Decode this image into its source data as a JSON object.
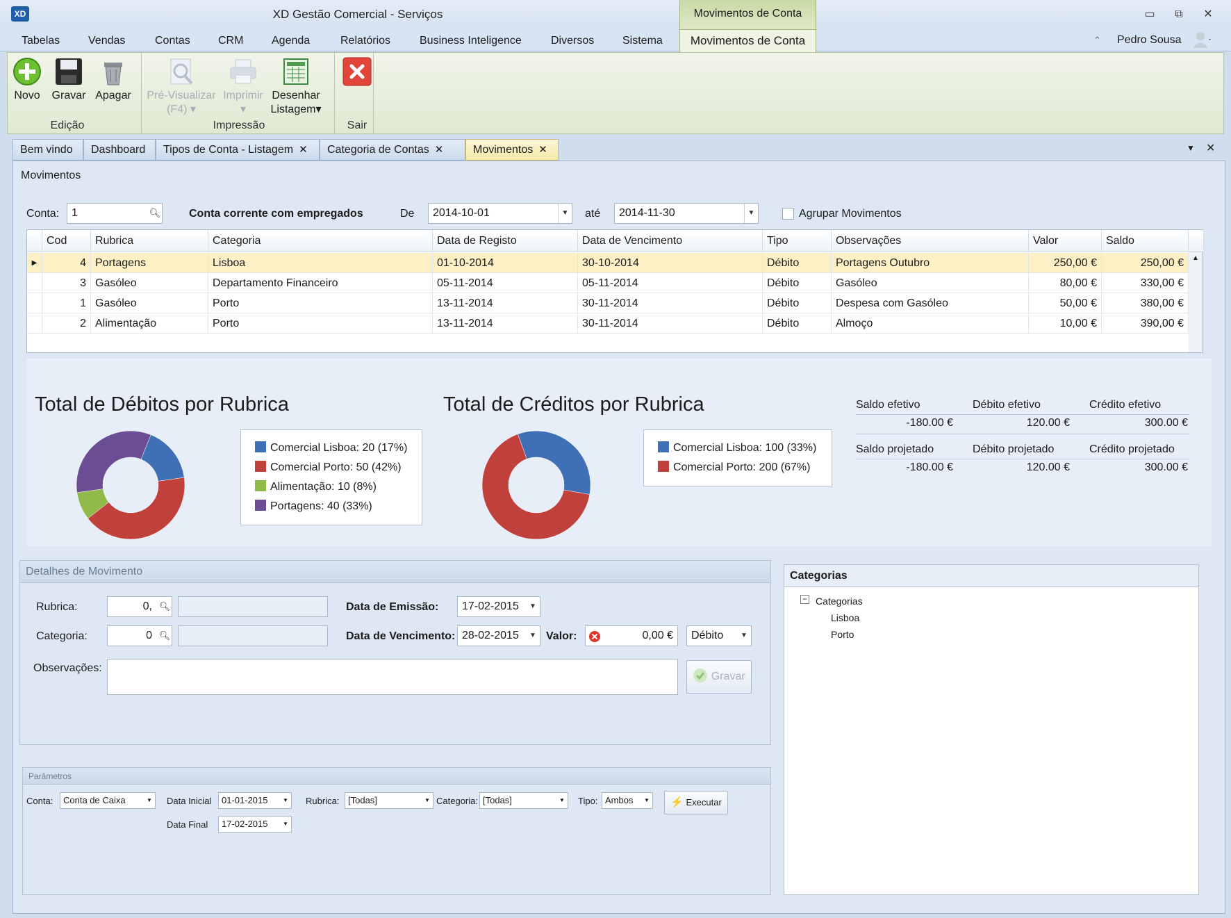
{
  "window": {
    "title": "XD Gestão Comercial - Serviços",
    "context_tab_header": "Movimentos de Conta",
    "minimize": "▭",
    "restore": "⧉",
    "close": "✕"
  },
  "menu": {
    "items": [
      "Tabelas",
      "Vendas",
      "Contas",
      "CRM",
      "Agenda",
      "Relatórios",
      "Business Inteligence",
      "Diversos",
      "Sistema"
    ],
    "active": "Movimentos de Conta",
    "user": "Pedro Sousa"
  },
  "ribbon": {
    "novo": "Novo",
    "gravar": "Gravar",
    "apagar": "Apagar",
    "previsualizar": "Pré-Visualizar",
    "previsualizar_key": "(F4)",
    "imprimir": "Imprimir",
    "desenhar_1": "Desenhar",
    "desenhar_2": "Listagem",
    "sair_label": "",
    "group_edicao": "Edição",
    "group_impressao": "Impressão",
    "group_sair": "Sair"
  },
  "tabs": [
    {
      "label": "Bem vindo"
    },
    {
      "label": "Dashboard"
    },
    {
      "label": "Tipos de Conta - Listagem"
    },
    {
      "label": "Categoria de Contas"
    },
    {
      "label": "Movimentos"
    }
  ],
  "page": {
    "title": "Movimentos"
  },
  "filter": {
    "conta_label": "Conta:",
    "conta_value": "1",
    "conta_name": "Conta corrente com empregados",
    "de_label": "De",
    "de_value": "2014-10-01",
    "ate_label": "até",
    "ate_value": "2014-11-30",
    "agrupar_label": "Agrupar Movimentos"
  },
  "grid": {
    "columns": [
      "Cod",
      "Rubrica",
      "Categoria",
      "Data de Registo",
      "Data de Vencimento",
      "Tipo",
      "Observações",
      "Valor",
      "Saldo"
    ],
    "rows": [
      [
        "4",
        "Portagens",
        "Lisboa",
        "01-10-2014",
        "30-10-2014",
        "Débito",
        "Portagens Outubro",
        "250,00 €",
        "250,00 €"
      ],
      [
        "3",
        "Gasóleo",
        "Departamento Financeiro",
        "05-11-2014",
        "05-11-2014",
        "Débito",
        "Gasóleo",
        "80,00 €",
        "330,00 €"
      ],
      [
        "1",
        "Gasóleo",
        "Porto",
        "13-11-2014",
        "30-11-2014",
        "Débito",
        "Despesa com Gasóleo",
        "50,00 €",
        "380,00 €"
      ],
      [
        "2",
        "Alimentação",
        "Porto",
        "13-11-2014",
        "30-11-2014",
        "Débito",
        "Almoço",
        "10,00 €",
        "390,00 €"
      ]
    ]
  },
  "chart_data": [
    {
      "type": "pie",
      "title": "Total de Débitos por Rubrica",
      "categories": [
        "Comercial Lisboa",
        "Comercial Porto",
        "Alimentação",
        "Portagens"
      ],
      "values": [
        20,
        50,
        10,
        40
      ],
      "legend": [
        "Comercial Lisboa: 20 (17%)",
        "Comercial Porto: 50 (42%)",
        "Alimentação: 10 (8%)",
        "Portagens: 40 (33%)"
      ],
      "colors": [
        "#3f6fb5",
        "#c0403c",
        "#8fba4a",
        "#6b4d96"
      ]
    },
    {
      "type": "pie",
      "title": "Total de Créditos por Rubrica",
      "categories": [
        "Comercial Lisboa",
        "Comercial Porto"
      ],
      "values": [
        100,
        200
      ],
      "legend": [
        "Comercial Lisboa: 100 (33%)",
        "Comercial Porto: 200 (67%)"
      ],
      "colors": [
        "#3f6fb5",
        "#c0403c"
      ]
    }
  ],
  "summary": {
    "saldo_efetivo_label": "Saldo efetivo",
    "saldo_efetivo": "-180.00 €",
    "debito_efetivo_label": "Débito efetivo",
    "debito_efetivo": "120.00 €",
    "credito_efetivo_label": "Crédito efetivo",
    "credito_efetivo": "300.00 €",
    "saldo_projetado_label": "Saldo projetado",
    "saldo_projetado": "-180.00 €",
    "debito_projetado_label": "Débito projetado",
    "debito_projetado": "120.00 €",
    "credito_projetado_label": "Crédito projetado",
    "credito_projetado": "300.00 €"
  },
  "details": {
    "header": "Detalhes de Movimento",
    "rubrica_label": "Rubrica:",
    "rubrica_value": "0,",
    "categoria_label": "Categoria:",
    "categoria_value": "0",
    "emissao_label": "Data de Emissão:",
    "emissao_value": "17-02-2015",
    "vencimento_label": "Data de Vencimento:",
    "vencimento_value": "28-02-2015",
    "valor_label": "Valor:",
    "valor_value": "0,00 €",
    "tipo_value": "Débito",
    "observacoes_label": "Observações:",
    "gravar": "Gravar"
  },
  "categories_panel": {
    "header": "Categorias",
    "root": "Categorias",
    "children": [
      "Lisboa",
      "Porto"
    ]
  },
  "params": {
    "header": "Parâmetros",
    "conta_label": "Conta:",
    "conta_value": "Conta de Caixa",
    "data_inicial_label": "Data Inicial",
    "data_inicial_value": "01-01-2015",
    "data_final_label": "Data Final",
    "data_final_value": "17-02-2015",
    "rubrica_label": "Rubrica:",
    "rubrica_value": "[Todas]",
    "categoria_label": "Categoria:",
    "categoria_value": "[Todas]",
    "tipo_label": "Tipo:",
    "tipo_value": "Ambos",
    "executar": "Executar"
  }
}
